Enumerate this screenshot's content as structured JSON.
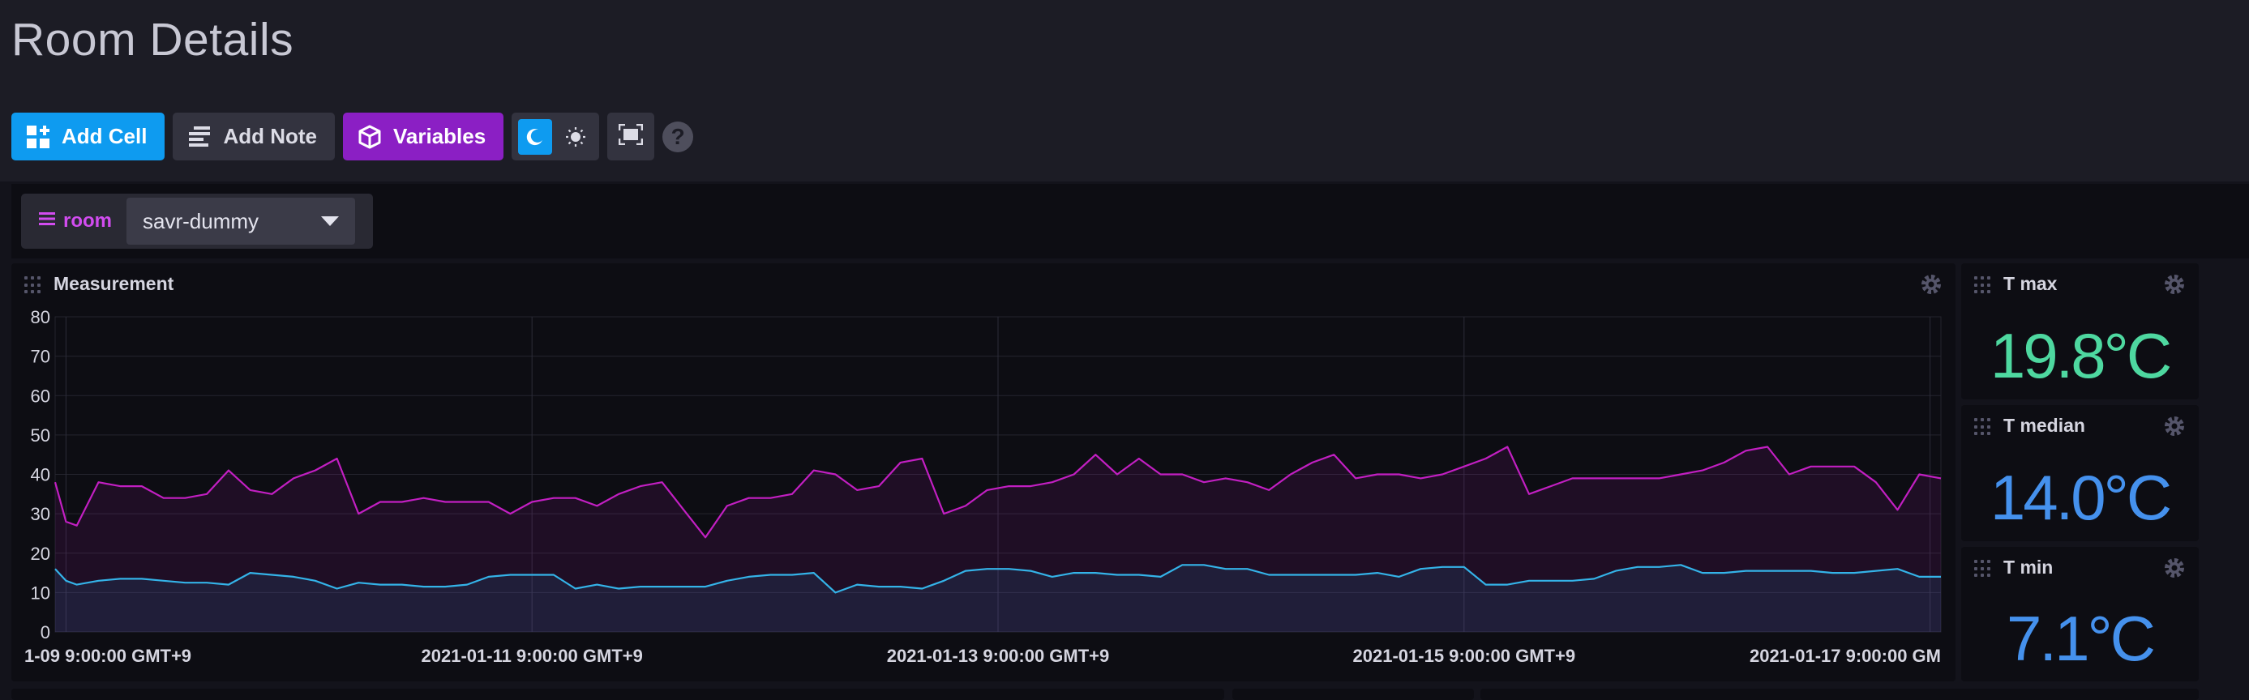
{
  "page": {
    "title": "Room Details"
  },
  "toolbar": {
    "add_cell": "Add Cell",
    "add_note": "Add Note",
    "variables": "Variables",
    "help": "?"
  },
  "variables": {
    "name": "room",
    "selected": "savr-dummy"
  },
  "cells": {
    "measurement": {
      "title": "Measurement"
    },
    "tmax": {
      "title": "T max",
      "value": "19.8°C",
      "color": "#4ed8a0"
    },
    "tmedian": {
      "title": "T median",
      "value": "14.0°C",
      "color": "#4591ed"
    },
    "tmin": {
      "title": "T min",
      "value": "7.1°C",
      "color": "#4591ed"
    }
  },
  "chart_data": {
    "type": "line",
    "title": "Measurement",
    "ylim": [
      0,
      80
    ],
    "yticks": [
      0,
      10,
      20,
      30,
      40,
      50,
      60,
      70,
      80
    ],
    "xtick_labels": [
      "1-09 9:00:00 GMT+9",
      "2021-01-11 9:00:00 GMT+9",
      "2021-01-13 9:00:00 GMT+9",
      "2021-01-15 9:00:00 GMT+9",
      "2021-01-17 9:00:00 GM"
    ],
    "x_days_range": [
      0,
      8.7
    ],
    "colors": {
      "humidity": "#c21fc2",
      "temperature": "#34b3e8"
    },
    "series": [
      {
        "values_x": [
          0,
          0.05,
          0.1,
          0.2,
          0.3,
          0.4,
          0.5,
          0.6,
          0.7,
          0.8,
          0.9,
          1.0,
          1.1,
          1.2,
          1.3,
          1.4,
          1.5,
          1.6,
          1.7,
          1.8,
          1.9,
          2.0,
          2.1,
          2.2,
          2.3,
          2.4,
          2.5,
          2.6,
          2.7,
          2.8,
          2.9,
          3.0,
          3.1,
          3.2,
          3.3,
          3.4,
          3.5,
          3.6,
          3.7,
          3.8,
          3.9,
          4.0,
          4.1,
          4.2,
          4.3,
          4.4,
          4.5,
          4.6,
          4.7,
          4.8,
          4.9,
          5.0,
          5.1,
          5.2,
          5.3,
          5.4,
          5.5,
          5.6,
          5.7,
          5.8,
          5.9,
          6.0,
          6.1,
          6.2,
          6.3,
          6.4,
          6.5,
          6.6,
          6.7,
          6.8,
          6.9,
          7.0,
          7.1,
          7.2,
          7.3,
          7.4,
          7.5,
          7.6,
          7.7,
          7.8,
          7.9,
          8.0,
          8.1,
          8.2,
          8.3,
          8.4,
          8.5,
          8.6,
          8.7
        ],
        "values": [
          38,
          28,
          27,
          38,
          37,
          37,
          34,
          34,
          35,
          41,
          36,
          35,
          39,
          41,
          44,
          30,
          33,
          33,
          34,
          33,
          33,
          33,
          30,
          33,
          34,
          34,
          32,
          35,
          37,
          38,
          31,
          24,
          32,
          34,
          34,
          35,
          41,
          40,
          36,
          37,
          43,
          44,
          30,
          32,
          36,
          37,
          37,
          38,
          40,
          45,
          40,
          44,
          40,
          40,
          38,
          39,
          38,
          36,
          40,
          43,
          45,
          39,
          40,
          40,
          39,
          40,
          42,
          44,
          47,
          35,
          37,
          39,
          39,
          39,
          39,
          39,
          40,
          41,
          43,
          46,
          47,
          40,
          42,
          42,
          42,
          38,
          31,
          40,
          39
        ]
      },
      {
        "values_x": [
          0,
          0.05,
          0.1,
          0.2,
          0.3,
          0.4,
          0.5,
          0.6,
          0.7,
          0.8,
          0.9,
          1.0,
          1.1,
          1.2,
          1.3,
          1.4,
          1.5,
          1.6,
          1.7,
          1.8,
          1.9,
          2.0,
          2.1,
          2.2,
          2.3,
          2.4,
          2.5,
          2.6,
          2.7,
          2.8,
          2.9,
          3.0,
          3.1,
          3.2,
          3.3,
          3.4,
          3.5,
          3.6,
          3.7,
          3.8,
          3.9,
          4.0,
          4.1,
          4.2,
          4.3,
          4.4,
          4.5,
          4.6,
          4.7,
          4.8,
          4.9,
          5.0,
          5.1,
          5.2,
          5.3,
          5.4,
          5.5,
          5.6,
          5.7,
          5.8,
          5.9,
          6.0,
          6.1,
          6.2,
          6.3,
          6.4,
          6.5,
          6.6,
          6.7,
          6.8,
          6.9,
          7.0,
          7.1,
          7.2,
          7.3,
          7.4,
          7.5,
          7.6,
          7.7,
          7.8,
          7.9,
          8.0,
          8.1,
          8.2,
          8.3,
          8.4,
          8.5,
          8.6,
          8.7
        ],
        "values": [
          16,
          13,
          12,
          13,
          13.5,
          13.5,
          13,
          12.5,
          12.5,
          12,
          15,
          14.5,
          14,
          13,
          11,
          12.5,
          12,
          12,
          11.5,
          11.5,
          12,
          14,
          14.5,
          14.5,
          14.5,
          11,
          12,
          11,
          11.5,
          11.5,
          11.5,
          11.5,
          13,
          14,
          14.5,
          14.5,
          15,
          10,
          12,
          11.5,
          11.5,
          11,
          13,
          15.5,
          16,
          16,
          15.5,
          14,
          15,
          15,
          14.5,
          14.5,
          14,
          17,
          17,
          16,
          16,
          14.5,
          14.5,
          14.5,
          14.5,
          14.5,
          15,
          14,
          16,
          16.5,
          16.5,
          12,
          12,
          13,
          13,
          13,
          13.5,
          15.5,
          16.5,
          16.5,
          17,
          15,
          15,
          15.5,
          15.5,
          15.5,
          15.5,
          15,
          15,
          15.5,
          16,
          14,
          14
        ]
      }
    ]
  }
}
